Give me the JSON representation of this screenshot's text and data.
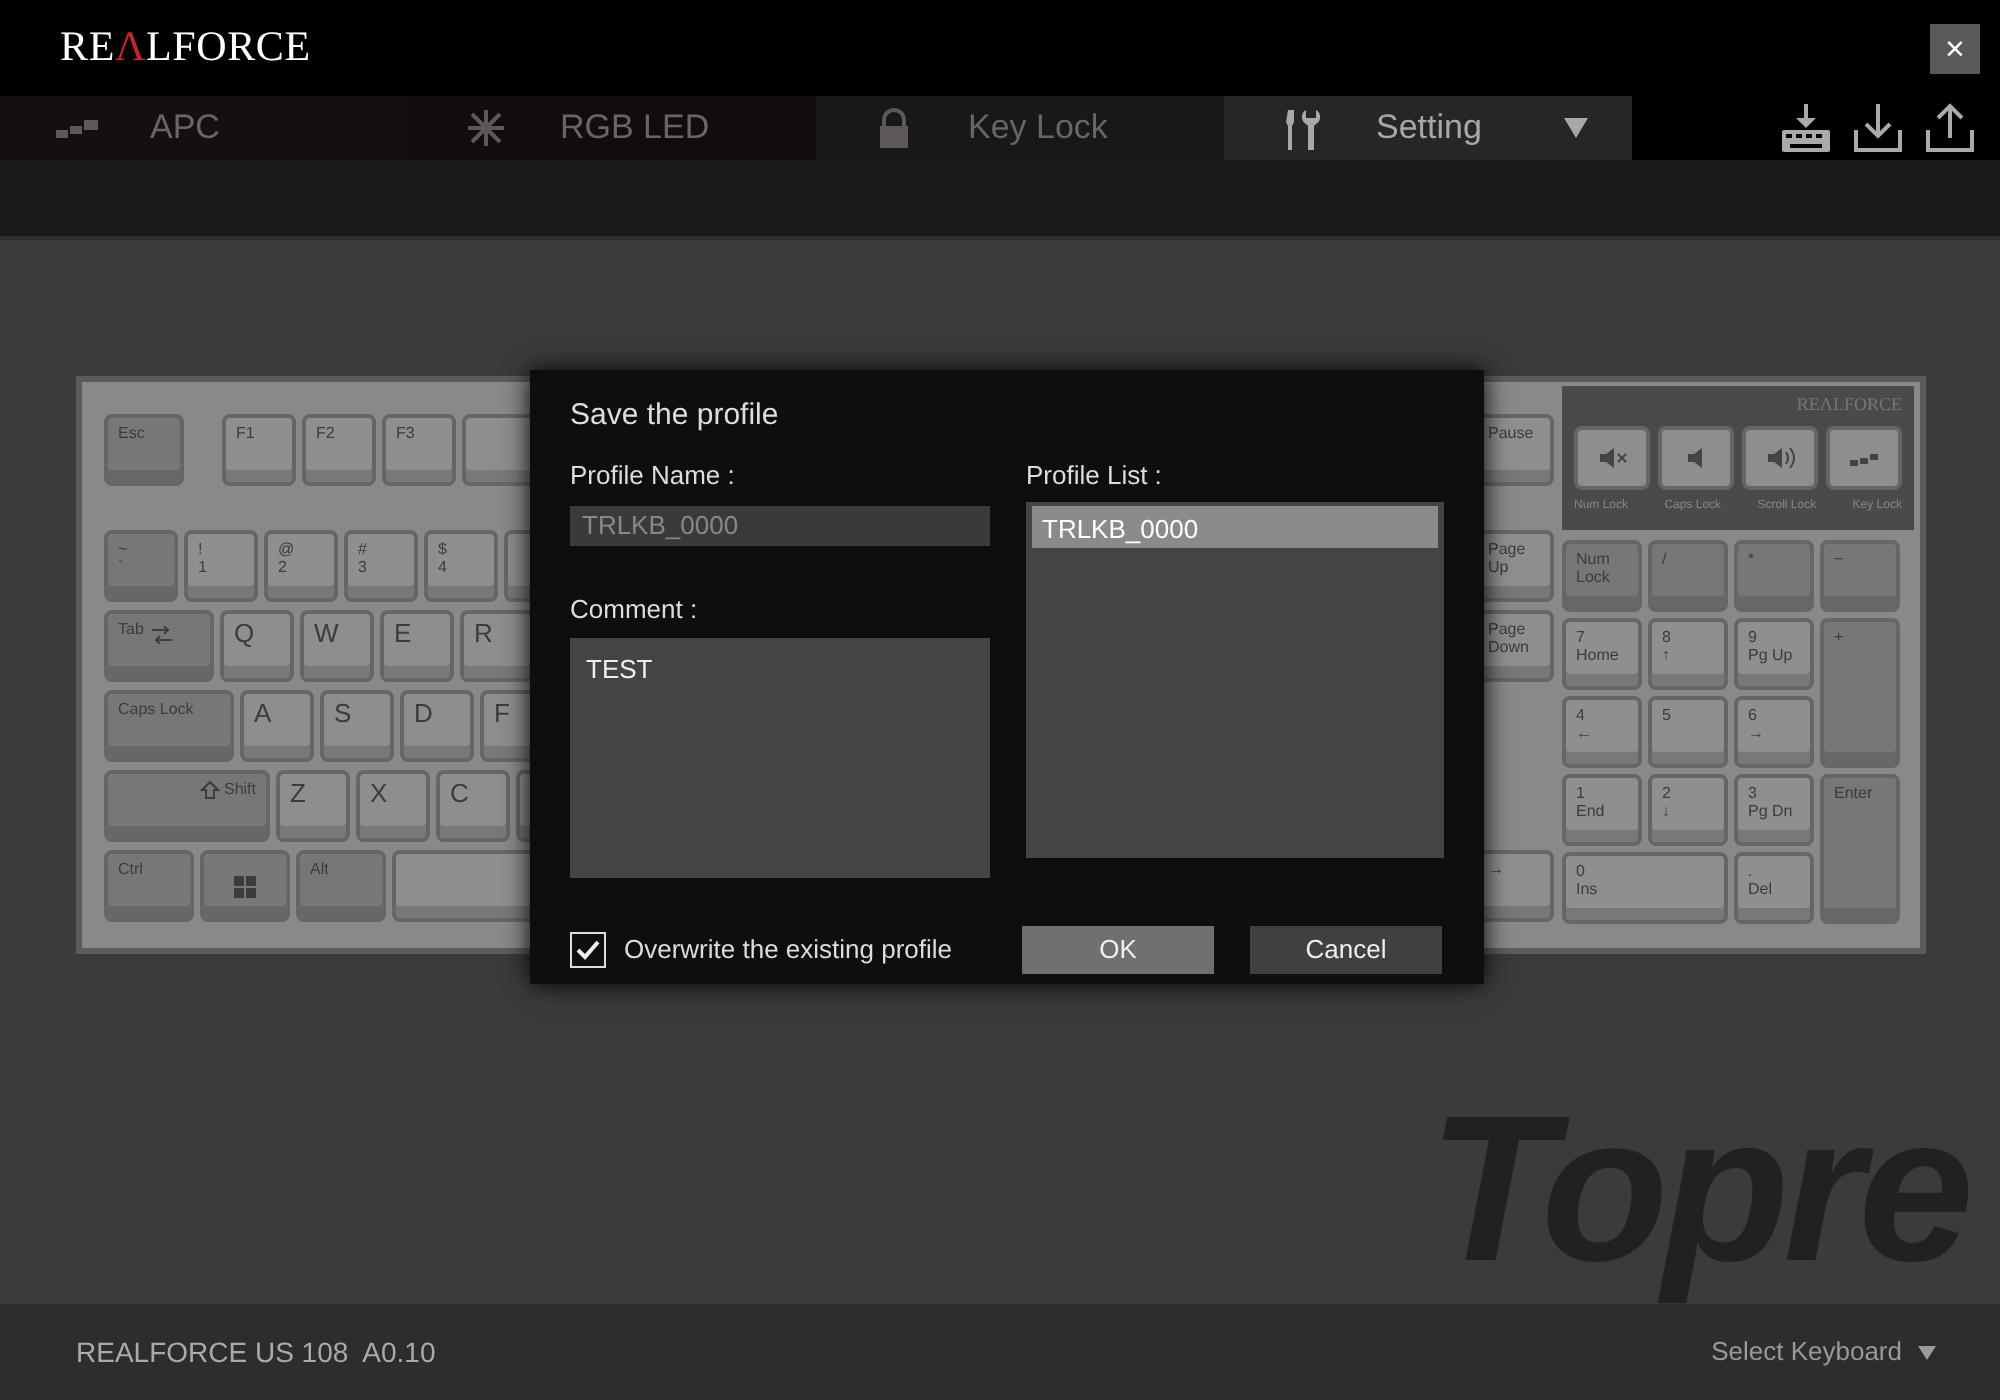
{
  "window": {
    "logo": "REΛLFORCE",
    "close": "×"
  },
  "tabs": [
    {
      "label": "APC",
      "selected": false
    },
    {
      "label": "RGB LED",
      "selected": false
    },
    {
      "label": "Key Lock",
      "selected": false
    },
    {
      "label": "Setting",
      "selected": true
    }
  ],
  "keyboard": {
    "brand": "REΛLFORCE",
    "left_rows": [
      [
        {
          "legends": [
            "Esc"
          ],
          "kind": "mod"
        },
        {
          "legends": [
            "F1"
          ],
          "kind": "char"
        },
        {
          "legends": [
            "F2"
          ],
          "kind": "char"
        },
        {
          "legends": [
            "F3"
          ],
          "kind": "char"
        }
      ],
      [
        {
          "legends": [
            "~",
            "`"
          ],
          "kind": "mod"
        },
        {
          "legends": [
            "!",
            "1"
          ],
          "kind": "char"
        },
        {
          "legends": [
            "@",
            "2"
          ],
          "kind": "char"
        },
        {
          "legends": [
            "#",
            "3"
          ],
          "kind": "char"
        },
        {
          "legends": [
            "$",
            "4"
          ],
          "kind": "char"
        }
      ],
      [
        {
          "legends": [
            "Tab"
          ],
          "kind": "mod"
        },
        {
          "legends": [
            "Q"
          ],
          "kind": "letter"
        },
        {
          "legends": [
            "W"
          ],
          "kind": "letter"
        },
        {
          "legends": [
            "E"
          ],
          "kind": "letter"
        },
        {
          "legends": [
            "R"
          ],
          "kind": "letter"
        }
      ],
      [
        {
          "legends": [
            "Caps Lock"
          ],
          "kind": "mod"
        },
        {
          "legends": [
            "A"
          ],
          "kind": "letter"
        },
        {
          "legends": [
            "S"
          ],
          "kind": "letter"
        },
        {
          "legends": [
            "D"
          ],
          "kind": "letter"
        },
        {
          "legends": [
            "F"
          ],
          "kind": "letter"
        }
      ],
      [
        {
          "legends": [
            "Shift"
          ],
          "kind": "mod"
        },
        {
          "legends": [
            "Z"
          ],
          "kind": "letter"
        },
        {
          "legends": [
            "X"
          ],
          "kind": "letter"
        },
        {
          "legends": [
            "C"
          ],
          "kind": "letter"
        }
      ],
      [
        {
          "legends": [
            "Ctrl"
          ],
          "kind": "mod"
        },
        {
          "kind": "mod"
        },
        {
          "legends": [
            "Alt"
          ],
          "kind": "mod"
        },
        {
          "kind": "char"
        }
      ]
    ],
    "nav_keys": [
      {
        "legends": [
          "Pause"
        ],
        "kind": "char"
      },
      {
        "legends": [
          "Page",
          "Up"
        ],
        "kind": "char"
      },
      {
        "legends": [
          "Page",
          "Down"
        ],
        "kind": "char"
      },
      {
        "legends": [
          "→"
        ],
        "kind": "char"
      }
    ],
    "indicators": [
      "Num Lock",
      "Caps Lock",
      "Scroll Lock",
      "Key Lock"
    ],
    "numpad": [
      {
        "legends": [
          "Num",
          "Lock"
        ],
        "kind": "mod"
      },
      {
        "legends": [
          "/"
        ],
        "kind": "mod"
      },
      {
        "legends": [
          "*"
        ],
        "kind": "mod"
      },
      {
        "legends": [
          "−"
        ],
        "kind": "mod"
      },
      {
        "legends": [
          "7",
          "Home"
        ],
        "kind": "char"
      },
      {
        "legends": [
          "8",
          "↑"
        ],
        "kind": "char"
      },
      {
        "legends": [
          "9",
          "Pg Up"
        ],
        "kind": "char"
      },
      {
        "legends": [
          "+"
        ],
        "kind": "mod"
      },
      {
        "legends": [
          "4",
          "←"
        ],
        "kind": "char"
      },
      {
        "legends": [
          "5"
        ],
        "kind": "char"
      },
      {
        "legends": [
          "6",
          "→"
        ],
        "kind": "char"
      },
      {
        "legends": [
          "1",
          "End"
        ],
        "kind": "char"
      },
      {
        "legends": [
          "2",
          "↓"
        ],
        "kind": "char"
      },
      {
        "legends": [
          "3",
          "Pg Dn"
        ],
        "kind": "char"
      },
      {
        "legends": [
          "Enter"
        ],
        "kind": "mod"
      },
      {
        "legends": [
          "0",
          "Ins"
        ],
        "kind": "char"
      },
      {
        "legends": [
          ".",
          "Del"
        ],
        "kind": "char"
      }
    ]
  },
  "background_logo": "Topre",
  "dialog": {
    "title": "Save the profile",
    "profile_name": {
      "label": "Profile Name :",
      "value": "TRLKB_0000",
      "disabled": true
    },
    "comment": {
      "label": "Comment :",
      "value": "TEST"
    },
    "profile_list": {
      "label": "Profile List :",
      "items": [
        {
          "label": "TRLKB_0000",
          "selected": true
        }
      ]
    },
    "overwrite": {
      "label": "Overwrite the existing profile",
      "checked": true
    },
    "buttons": [
      "OK",
      "Cancel"
    ]
  },
  "status_bar": {
    "model": "REALFORCE US 108  A0.10",
    "select": "Select Keyboard"
  }
}
